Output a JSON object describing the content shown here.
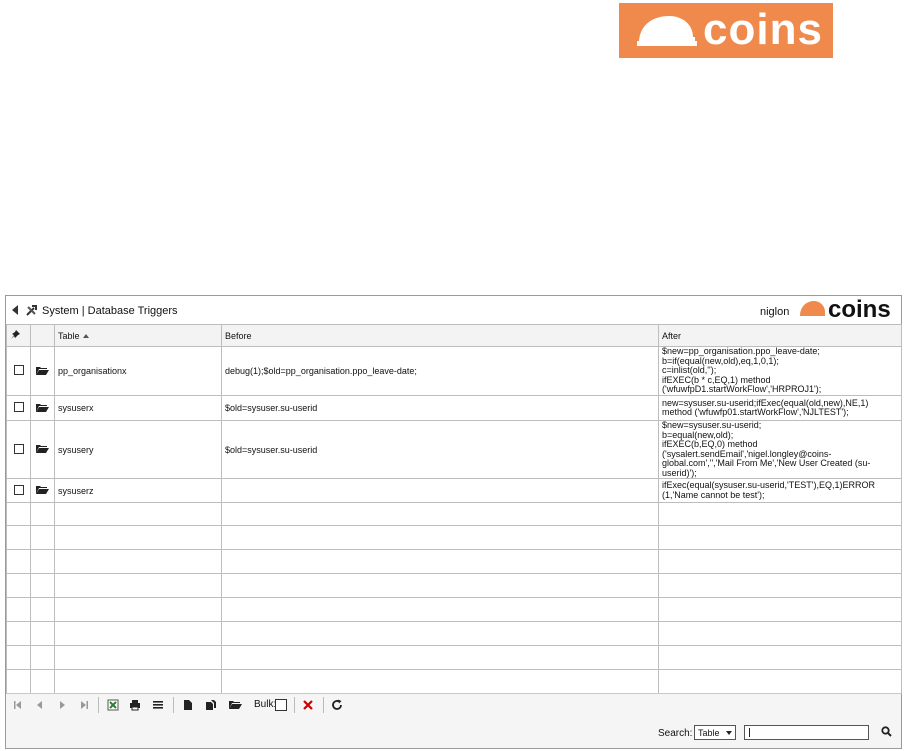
{
  "brand": {
    "logo_text": "coins",
    "color": "#ef8a4c"
  },
  "window": {
    "breadcrumb": "System | Database Triggers",
    "user": "niglon",
    "mini_logo_text": "coins"
  },
  "grid": {
    "columns": {
      "table": "Table",
      "before": "Before",
      "after": "After"
    },
    "rows": [
      {
        "table": "pp_organisationx",
        "before": "debug(1);$old=pp_organisation.ppo_leave-date;",
        "after": [
          "$new=pp_organisation.ppo_leave-date;",
          "b=if(equal(new,old),eq,1,0,1);",
          "c=inlist(old,'');",
          "ifEXEC(b * c,EQ,1) method",
          "('wfuwfpD1.startWorkFlow','HRPROJ1');"
        ]
      },
      {
        "table": "sysuserx",
        "before": "$old=sysuser.su-userid",
        "after": [
          "new=sysuser.su-userid;ifExec(equal(old,new),NE,1)",
          "method ('wfuwfp01.startWorkFlow','NJLTEST');"
        ]
      },
      {
        "table": "sysusery",
        "before": "$old=sysuser.su-userid",
        "after": [
          "$new=sysuser.su-userid;",
          "b=equal(new,old);",
          "ifEXEC(b,EQ,0) method",
          "('sysalert.sendEmail','nigel.longley@coins-",
          "global.com','','Mail From Me','New User Created (su-",
          "userid)');"
        ]
      },
      {
        "table": "sysuserz",
        "before": "",
        "after": [
          "ifExec(equal(sysuser.su-userid,'TEST'),EQ,1)ERROR",
          "(1,'Name cannot be test');"
        ]
      }
    ]
  },
  "toolbar": {
    "bulk_label": "Bulk:"
  },
  "search": {
    "label": "Search:",
    "selected": "Table",
    "value": ""
  },
  "colors": {
    "delete": "#cc0000",
    "export": "#2e7d32"
  }
}
